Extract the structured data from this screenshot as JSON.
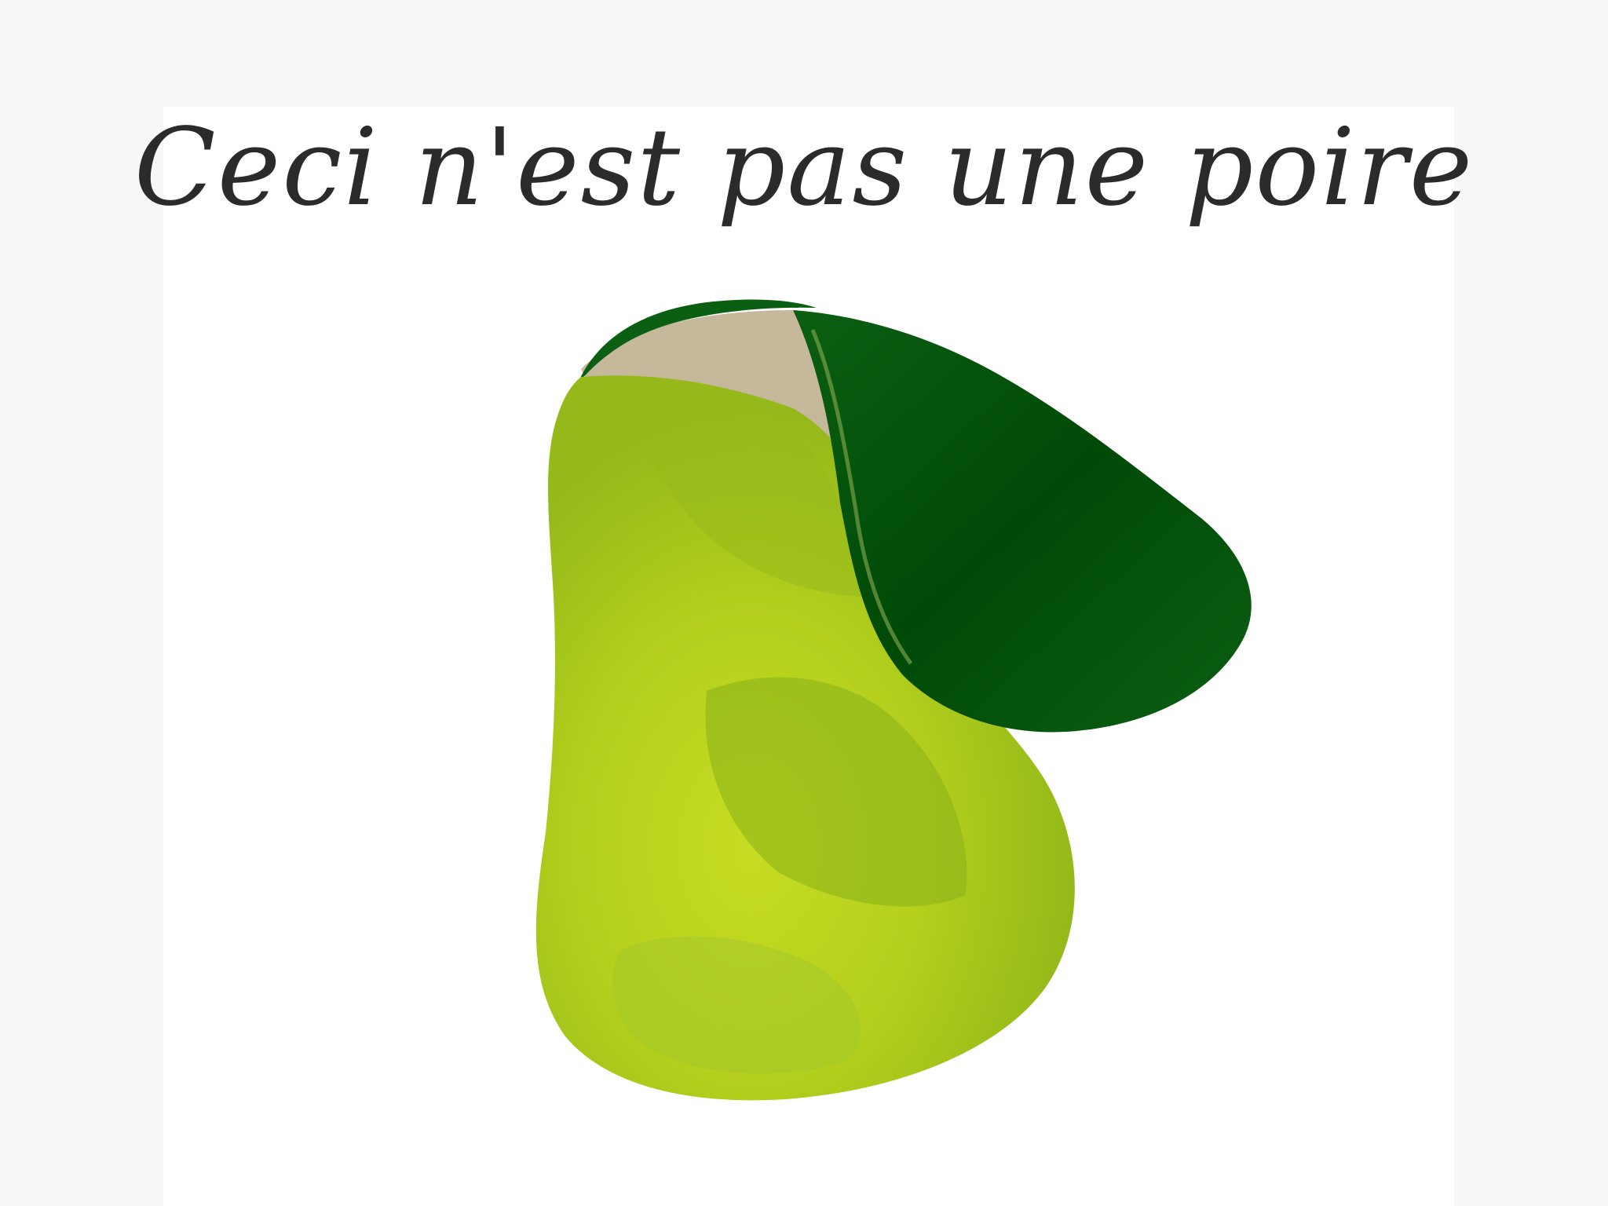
{
  "caption": "Ceci n'est pas une poire",
  "colors": {
    "background": "#f7f7f7",
    "card": "#ffffff",
    "text": "#2b2b2b",
    "pear_light": "#c2d81c",
    "pear_mid": "#9bbb1a",
    "pear_shadow": "#86ad16",
    "pear_inner": "#c6b89a",
    "leaf_dark": "#004f07",
    "leaf_edge": "#0a6112"
  },
  "icons": [
    "pear-illustration",
    "leaf-illustration"
  ]
}
